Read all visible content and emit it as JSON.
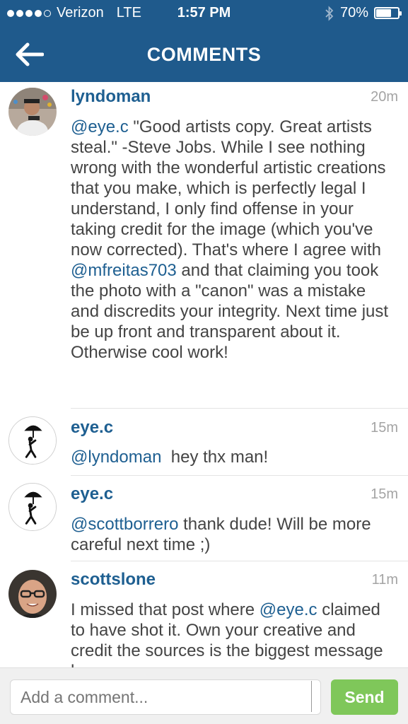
{
  "status": {
    "carrier": "Verizon",
    "network": "LTE",
    "time": "1:57 PM",
    "battery": "70%",
    "battery_level": 0.7
  },
  "nav": {
    "title": "COMMENTS",
    "back_icon": "back-arrow-icon"
  },
  "comments": [
    {
      "username": "lyndoman",
      "time": "20m",
      "parts": [
        {
          "t": "@eye.c",
          "m": true
        },
        {
          "t": " \"Good artists copy. Great artists steal.\" -Steve Jobs. While I see nothing wrong with the wonderful artistic creations that you make, which is perfectly legal I understand, I only find offense in your taking credit for the image (which you've now corrected). That's where I agree with ",
          "m": false
        },
        {
          "t": "@mfreitas703",
          "m": true
        },
        {
          "t": " and that claiming you took the photo with a \"canon\" was a mistake and discredits your integrity. Next time just be up front and transparent about it. Otherwise cool work!",
          "m": false
        }
      ]
    },
    {
      "username": "eye.c",
      "time": "15m",
      "parts": [
        {
          "t": "@lyndoman",
          "m": true
        },
        {
          "t": "  hey thx man!",
          "m": false
        }
      ]
    },
    {
      "username": "eye.c",
      "time": "15m",
      "parts": [
        {
          "t": "@scottborrero",
          "m": true
        },
        {
          "t": " thank dude! Will be more careful next time ;)",
          "m": false
        }
      ]
    },
    {
      "username": "scottslone",
      "time": "11m",
      "parts": [
        {
          "t": "I missed that post where ",
          "m": false
        },
        {
          "t": "@eye.c",
          "m": true
        },
        {
          "t": " claimed to have shot it. Own your creative and credit the sources is the biggest message here",
          "m": false
        }
      ]
    }
  ],
  "composer": {
    "placeholder": "Add a comment...",
    "send_label": "Send"
  },
  "colors": {
    "header": "#1f5a8c",
    "link": "#1e5f91",
    "send": "#7fc75a"
  }
}
